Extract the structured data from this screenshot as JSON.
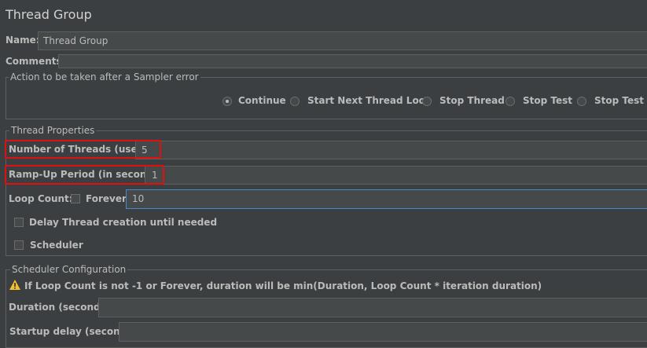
{
  "header": {
    "title": "Thread Group"
  },
  "name_field": {
    "label": "Name:",
    "value": "Thread Group"
  },
  "comments_field": {
    "label": "Comments:",
    "value": ""
  },
  "sampler_error": {
    "legend": "Action to be taken after a Sampler error",
    "options": [
      {
        "label": "Continue",
        "selected": true
      },
      {
        "label": "Start Next Thread Loop",
        "selected": false
      },
      {
        "label": "Stop Thread",
        "selected": false
      },
      {
        "label": "Stop Test",
        "selected": false
      },
      {
        "label": "Stop Test No",
        "selected": false
      }
    ]
  },
  "thread_properties": {
    "legend": "Thread Properties",
    "num_threads": {
      "label": "Number of Threads (users):",
      "value": "5"
    },
    "ramp_up": {
      "label": "Ramp-Up Period (in seconds):",
      "value": "1"
    },
    "loop_count": {
      "label": "Loop Count:",
      "forever_label": "Forever",
      "forever_checked": false,
      "value": "10"
    },
    "delay_creation": {
      "label": "Delay Thread creation until needed",
      "checked": false
    },
    "scheduler": {
      "label": "Scheduler",
      "checked": false
    }
  },
  "scheduler_config": {
    "legend": "Scheduler Configuration",
    "warning": "If Loop Count is not -1 or Forever, duration will be min(Duration, Loop Count * iteration duration)",
    "duration": {
      "label": "Duration (seconds)",
      "value": ""
    },
    "startup_delay": {
      "label": "Startup delay (seconds)",
      "value": ""
    }
  },
  "colors": {
    "background": "#3c3f41",
    "field": "#45494a",
    "highlight": "#e01010",
    "focus": "#4a88c7",
    "warning": "#f0c030"
  }
}
